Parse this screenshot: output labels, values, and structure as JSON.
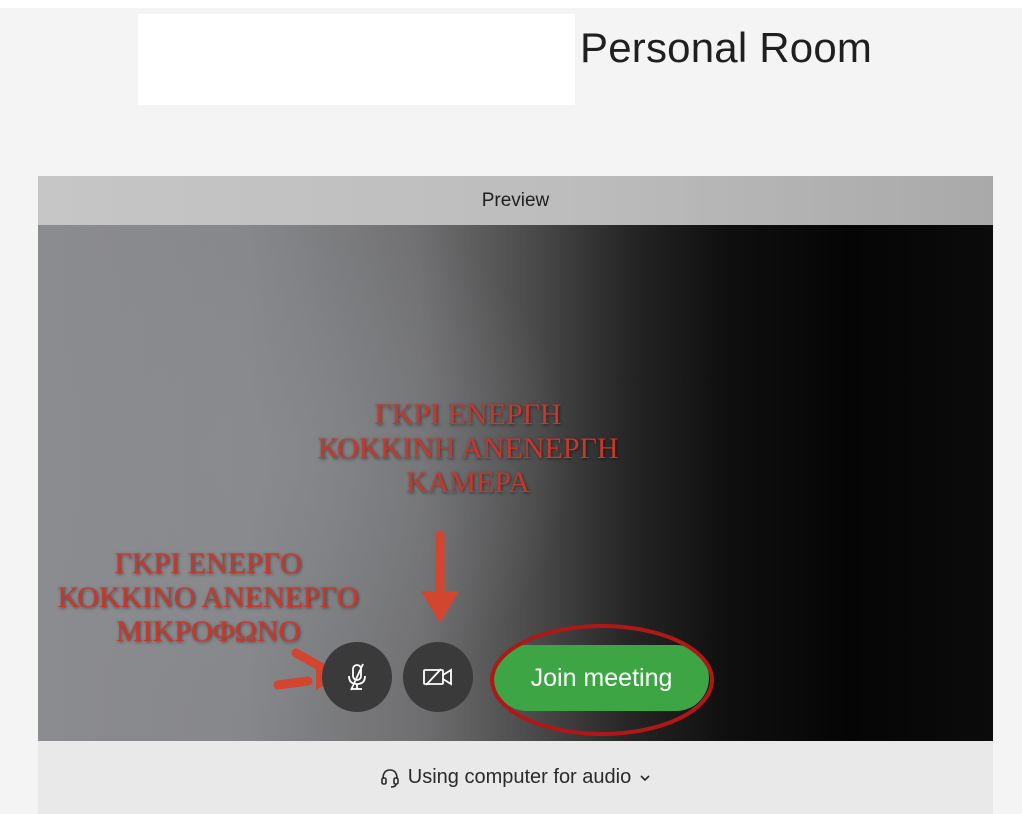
{
  "header": {
    "room_title": "Personal Room"
  },
  "preview": {
    "label": "Preview"
  },
  "annotations": {
    "camera": [
      "ΓΚΡΙ ΕΝΕΡΓΗ",
      "ΚΟΚΚΙΝΗ ΑΝΕΝΕΡΓΗ",
      "ΚΑΜΕΡΑ"
    ],
    "microphone": [
      "ΓΚΡΙ ΕΝΕΡΓΟ",
      "ΚΟΚΚΙΝΟ ΑΝΕΝΕΡΓΟ",
      "ΜΙΚΡΟΦΩΝΟ"
    ]
  },
  "controls": {
    "mic_icon": "microphone-muted-icon",
    "camera_icon": "video-camera-icon",
    "join_label": "Join meeting"
  },
  "audio": {
    "label": "Using computer for audio",
    "icon": "headset-icon"
  },
  "colors": {
    "join_green": "#3da544",
    "annotation_red": "#c8372a",
    "control_dark": "#3a3a3a"
  }
}
